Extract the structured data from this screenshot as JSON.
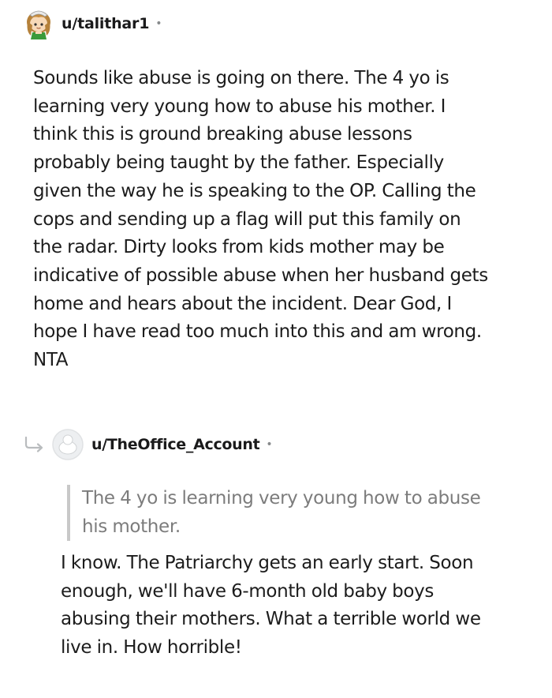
{
  "comments": [
    {
      "username": "u/talithar1",
      "separator": "•",
      "avatar_icon": "snoo-avatar-icon",
      "lines": [
        "Sounds like abuse is going on there. The 4 yo is",
        "learning very young how to abuse his mother. I",
        "think this is ground breaking abuse lessons",
        "probably being taught by the father. Especially",
        "given the way he is speaking to the OP. Calling the",
        "cops and sending up a flag will put this family on",
        "the radar. Dirty looks from kids mother may be",
        "indicative of possible abuse when her husband gets",
        "home and hears about the incident. Dear God, I",
        "hope I have read too much into this and am wrong.",
        "NTA"
      ]
    },
    {
      "username": "u/TheOffice_Account",
      "separator": "•",
      "avatar_icon": "default-avatar-icon",
      "reply_icon": "reply-arrow-icon",
      "quote_lines": [
        "The 4 yo is learning very young how to abuse",
        "his mother."
      ],
      "lines": [
        "I know. The Patriarchy gets an early start. Soon",
        "enough, we'll have 6-month old baby boys",
        "abusing their mothers. What a terrible world we",
        "live in. How horrible!"
      ]
    }
  ],
  "colors": {
    "text": "#1c1c1c",
    "meta": "#878a8c",
    "quote_text": "#7c7c7c",
    "quote_bar": "#c8c8c8"
  }
}
